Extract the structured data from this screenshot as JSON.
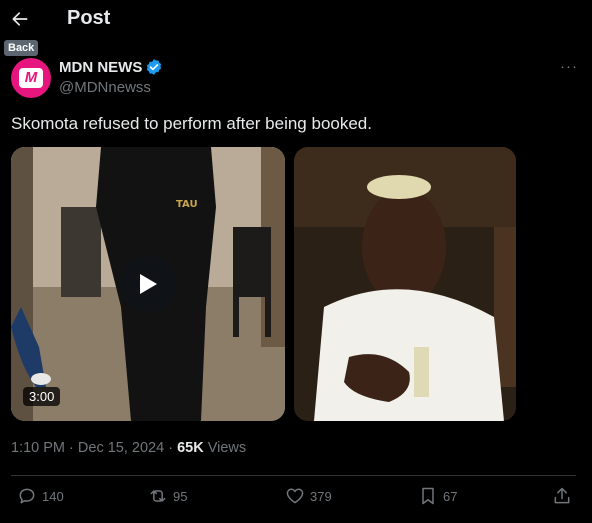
{
  "header": {
    "title": "Post",
    "back_tooltip": "Back",
    "back_icon": "arrow-left-icon"
  },
  "author": {
    "display_name": "MDN NEWS",
    "handle": "@MDNnewss",
    "avatar_text": "M",
    "avatar_color": "#e6167e",
    "verified": true,
    "more_label": "···"
  },
  "post": {
    "text": "Skomota refused to perform after being booked."
  },
  "media": {
    "video_duration": "3:00",
    "play_icon": "play-icon"
  },
  "meta": {
    "time": "1:10 PM",
    "separator": "·",
    "date": "Dec 15, 2024",
    "views_count": "65K",
    "views_label": "Views"
  },
  "actions": {
    "replies": "140",
    "reposts": "95",
    "likes": "379",
    "bookmarks": "67"
  },
  "colors": {
    "background": "#000000",
    "text": "#e7e9ea",
    "muted": "#71767b",
    "verified": "#1d9bf0",
    "divider": "#2f3336"
  }
}
